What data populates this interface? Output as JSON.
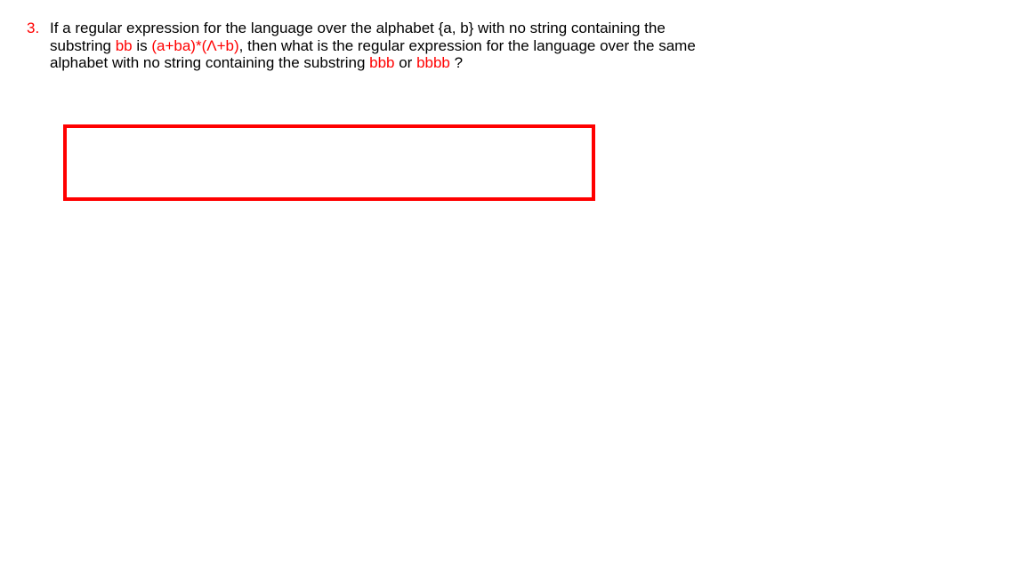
{
  "question": {
    "number": "3.",
    "text_parts": {
      "p1": "If a regular expression for the language over the alphabet {a, b} with no string containing the substring ",
      "r1": "bb",
      "p2": " is ",
      "r2": "(a+ba)*(Λ+b)",
      "p3": ", then what is the regular expression for the language over the same alphabet with no string containing the substring ",
      "r3": "bbb",
      "p4": " or ",
      "r4": "bbbb",
      "p5": " ?"
    }
  },
  "answer_box": {
    "content": ""
  }
}
